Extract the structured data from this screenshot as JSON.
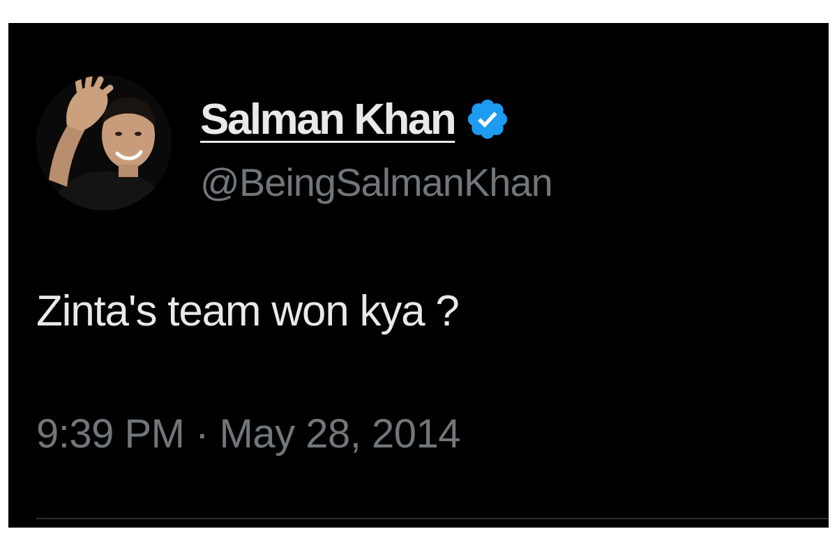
{
  "tweet": {
    "author": {
      "display_name": "Salman Khan",
      "handle": "@BeingSalmanKhan",
      "verified": true,
      "verified_icon": "verified-badge-icon",
      "avatar_icon": "profile-photo"
    },
    "text": "Zinta's team won kya ?",
    "timestamp": "9:39 PM · May 28, 2014"
  },
  "colors": {
    "background": "#000000",
    "page_background": "#ffffff",
    "primary_text": "#e7e9ea",
    "secondary_text": "#71767b",
    "verified_badge": "#1d9bf0",
    "divider": "#2f3336"
  }
}
